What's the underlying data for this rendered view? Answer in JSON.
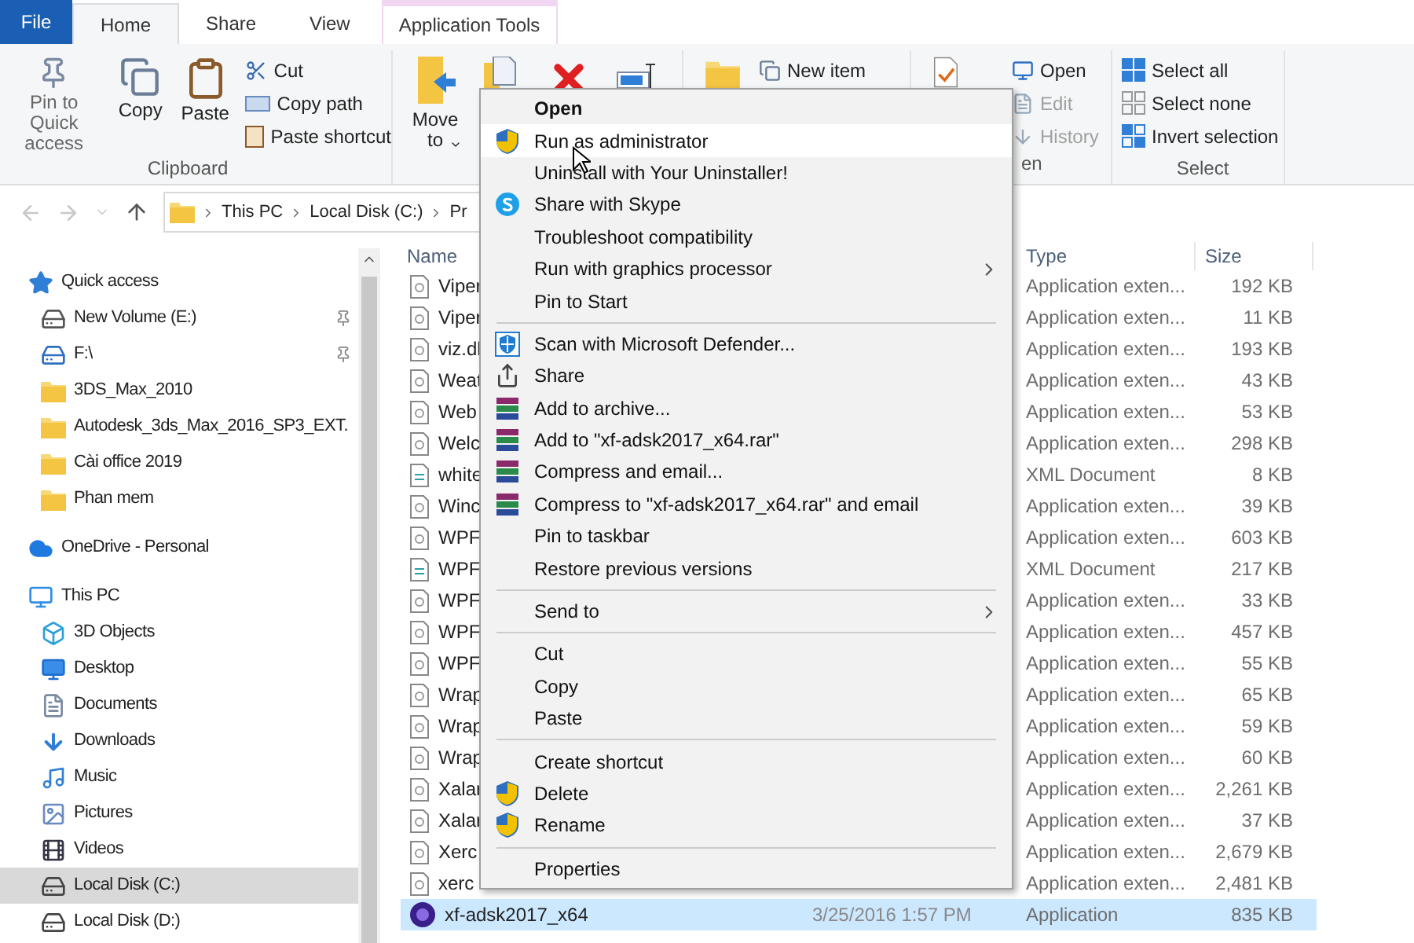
{
  "tabs": [
    {
      "label": "File",
      "kind": "file",
      "selected": false
    },
    {
      "label": "Home",
      "kind": "tab",
      "selected": true
    },
    {
      "label": "Share",
      "kind": "tab",
      "selected": false
    },
    {
      "label": "View",
      "kind": "tab",
      "selected": false
    },
    {
      "label": "Application Tools",
      "kind": "contextual",
      "selected": false
    }
  ],
  "ribbon": {
    "clipboard": {
      "large": [
        "Pin to Quick access",
        "Copy",
        "Paste"
      ],
      "small": [
        "Cut",
        "Copy path",
        "Paste shortcut"
      ],
      "label": "Clipboard"
    },
    "organize": {
      "move_to": "Move to"
    },
    "new": {
      "new_item": "New item"
    },
    "open": {
      "small": [
        {
          "label": "Open",
          "disabled": false
        },
        {
          "label": "Edit",
          "disabled": true
        },
        {
          "label": "History",
          "disabled": true
        }
      ],
      "label": "en"
    },
    "select": {
      "small": [
        "Select all",
        "Select none",
        "Invert selection"
      ],
      "label": "Select"
    }
  },
  "address": {
    "crumbs": [
      "This PC",
      "Local Disk (C:)",
      "Pr"
    ]
  },
  "nav": [
    {
      "label": "Quick access",
      "kind": "star",
      "selected": false,
      "children": [
        {
          "label": "New Volume (E:)",
          "kind": "drive",
          "pinned": true,
          "selected": false
        },
        {
          "label": "F:\\",
          "kind": "netdrive",
          "pinned": true,
          "selected": false
        },
        {
          "label": "3DS_Max_2010",
          "kind": "folder",
          "pinned": false,
          "selected": false
        },
        {
          "label": "Autodesk_3ds_Max_2016_SP3_EXT.",
          "kind": "folder",
          "pinned": false,
          "selected": false
        },
        {
          "label": "Cài office 2019",
          "kind": "folder",
          "pinned": false,
          "selected": false
        },
        {
          "label": "Phan mem",
          "kind": "folder",
          "pinned": false,
          "selected": false
        }
      ]
    },
    {
      "label": "OneDrive - Personal",
      "kind": "cloud",
      "selected": false
    },
    {
      "label": "This PC",
      "kind": "pc",
      "selected": false,
      "children": [
        {
          "label": "3D Objects",
          "kind": "objects",
          "selected": false
        },
        {
          "label": "Desktop",
          "kind": "desktop",
          "selected": false
        },
        {
          "label": "Documents",
          "kind": "documents",
          "selected": false
        },
        {
          "label": "Downloads",
          "kind": "downloads",
          "selected": false
        },
        {
          "label": "Music",
          "kind": "music",
          "selected": false
        },
        {
          "label": "Pictures",
          "kind": "pictures",
          "selected": false
        },
        {
          "label": "Videos",
          "kind": "videos",
          "selected": false
        },
        {
          "label": "Local Disk (C:)",
          "kind": "disk",
          "selected": true
        },
        {
          "label": "Local Disk (D:)",
          "kind": "disk",
          "selected": false
        }
      ]
    }
  ],
  "columns": {
    "name": "Name",
    "type": "Type",
    "size": "Size"
  },
  "files": [
    {
      "name": "Viper",
      "kind": "dll",
      "type": "Application exten...",
      "size": "192 KB",
      "selected": false
    },
    {
      "name": "Viper",
      "kind": "dll",
      "type": "Application exten...",
      "size": "11 KB",
      "selected": false
    },
    {
      "name": "viz.dl",
      "kind": "dll",
      "type": "Application exten...",
      "size": "193 KB",
      "selected": false
    },
    {
      "name": "Weat",
      "kind": "dll",
      "type": "Application exten...",
      "size": "43 KB",
      "selected": false
    },
    {
      "name": "Web",
      "kind": "dll",
      "type": "Application exten...",
      "size": "53 KB",
      "selected": false
    },
    {
      "name": "Welc",
      "kind": "dll",
      "type": "Application exten...",
      "size": "298 KB",
      "selected": false
    },
    {
      "name": "white",
      "kind": "xml",
      "type": "XML Document",
      "size": "8 KB",
      "selected": false
    },
    {
      "name": "Winc",
      "kind": "dll",
      "type": "Application exten...",
      "size": "39 KB",
      "selected": false
    },
    {
      "name": "WPF",
      "kind": "dll",
      "type": "Application exten...",
      "size": "603 KB",
      "selected": false
    },
    {
      "name": "WPF",
      "kind": "xml",
      "type": "XML Document",
      "size": "217 KB",
      "selected": false
    },
    {
      "name": "WPF",
      "kind": "dll",
      "type": "Application exten...",
      "size": "33 KB",
      "selected": false
    },
    {
      "name": "WPF",
      "kind": "dll",
      "type": "Application exten...",
      "size": "457 KB",
      "selected": false
    },
    {
      "name": "WPF",
      "kind": "dll",
      "type": "Application exten...",
      "size": "55 KB",
      "selected": false
    },
    {
      "name": "Wrap",
      "kind": "dll",
      "type": "Application exten...",
      "size": "65 KB",
      "selected": false
    },
    {
      "name": "Wrap",
      "kind": "dll",
      "type": "Application exten...",
      "size": "59 KB",
      "selected": false
    },
    {
      "name": "Wrap",
      "kind": "dll",
      "type": "Application exten...",
      "size": "60 KB",
      "selected": false
    },
    {
      "name": "Xalar",
      "kind": "dll",
      "type": "Application exten...",
      "size": "2,261 KB",
      "selected": false
    },
    {
      "name": "Xalar",
      "kind": "dll",
      "type": "Application exten...",
      "size": "37 KB",
      "selected": false
    },
    {
      "name": "Xerc",
      "kind": "dll",
      "type": "Application exten...",
      "size": "2,679 KB",
      "selected": false
    },
    {
      "name": "xerc",
      "kind": "dll",
      "type": "Application exten...",
      "size": "2,481 KB",
      "selected": false
    },
    {
      "name": "xf-adsk2017_x64",
      "kind": "app",
      "date": "3/25/2016 1:57 PM",
      "type": "Application",
      "size": "835 KB",
      "selected": true
    }
  ],
  "menu": [
    {
      "kind": "plain",
      "label": "Open",
      "default": true,
      "highlighted": false,
      "submenu": false
    },
    {
      "kind": "shield",
      "label": "Run as administrator",
      "default": false,
      "highlighted": true,
      "submenu": false
    },
    {
      "kind": "plain",
      "label": "Uninstall with Your Uninstaller!",
      "default": false,
      "highlighted": false,
      "submenu": false
    },
    {
      "kind": "skype",
      "label": "Share with Skype",
      "default": false,
      "highlighted": false,
      "submenu": false
    },
    {
      "kind": "plain",
      "label": "Troubleshoot compatibility",
      "default": false,
      "highlighted": false,
      "submenu": false
    },
    {
      "kind": "plain",
      "label": "Run with graphics processor",
      "default": false,
      "highlighted": false,
      "submenu": true
    },
    {
      "kind": "plain",
      "label": "Pin to Start",
      "default": false,
      "highlighted": false,
      "submenu": false
    },
    {
      "kind": "separator"
    },
    {
      "kind": "defender",
      "label": "Scan with Microsoft Defender...",
      "default": false,
      "highlighted": false,
      "submenu": false
    },
    {
      "kind": "share",
      "label": "Share",
      "default": false,
      "highlighted": false,
      "submenu": false
    },
    {
      "kind": "archive",
      "label": "Add to archive...",
      "default": false,
      "highlighted": false,
      "submenu": false
    },
    {
      "kind": "archive",
      "label": "Add to \"xf-adsk2017_x64.rar\"",
      "default": false,
      "highlighted": false,
      "submenu": false
    },
    {
      "kind": "archive",
      "label": "Compress and email...",
      "default": false,
      "highlighted": false,
      "submenu": false
    },
    {
      "kind": "archive",
      "label": "Compress to \"xf-adsk2017_x64.rar\" and email",
      "default": false,
      "highlighted": false,
      "submenu": false
    },
    {
      "kind": "plain",
      "label": "Pin to taskbar",
      "default": false,
      "highlighted": false,
      "submenu": false
    },
    {
      "kind": "plain",
      "label": "Restore previous versions",
      "default": false,
      "highlighted": false,
      "submenu": false
    },
    {
      "kind": "separator"
    },
    {
      "kind": "plain",
      "label": "Send to",
      "default": false,
      "highlighted": false,
      "submenu": true
    },
    {
      "kind": "separator"
    },
    {
      "kind": "plain",
      "label": "Cut",
      "default": false,
      "highlighted": false,
      "submenu": false
    },
    {
      "kind": "plain",
      "label": "Copy",
      "default": false,
      "highlighted": false,
      "submenu": false
    },
    {
      "kind": "plain",
      "label": "Paste",
      "default": false,
      "highlighted": false,
      "submenu": false
    },
    {
      "kind": "separator"
    },
    {
      "kind": "plain",
      "label": "Create shortcut",
      "default": false,
      "highlighted": false,
      "submenu": false
    },
    {
      "kind": "shield",
      "label": "Delete",
      "default": false,
      "highlighted": false,
      "submenu": false
    },
    {
      "kind": "shield",
      "label": "Rename",
      "default": false,
      "highlighted": false,
      "submenu": false
    },
    {
      "kind": "separator"
    },
    {
      "kind": "plain",
      "label": "Properties",
      "default": false,
      "highlighted": false,
      "submenu": false
    }
  ]
}
